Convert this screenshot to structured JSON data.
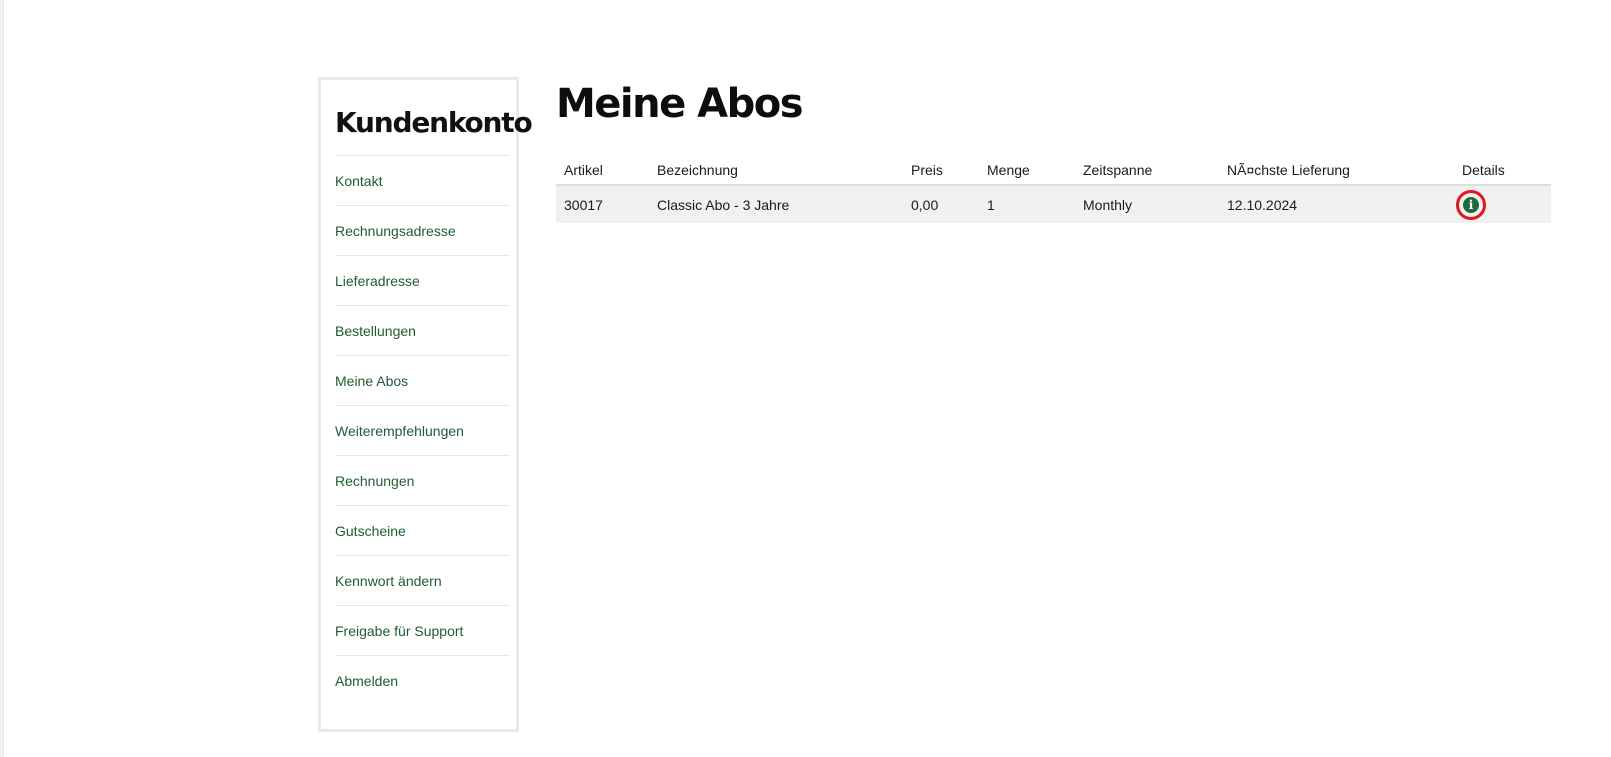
{
  "sidebar": {
    "title": "Kundenkonto",
    "items": [
      {
        "label": "Kontakt"
      },
      {
        "label": "Rechnungsadresse"
      },
      {
        "label": "Lieferadresse"
      },
      {
        "label": "Bestellungen"
      },
      {
        "label": "Meine Abos"
      },
      {
        "label": "Weiterempfehlungen"
      },
      {
        "label": "Rechnungen"
      },
      {
        "label": "Gutscheine"
      },
      {
        "label": "Kennwort ändern"
      },
      {
        "label": "Freigabe für Support"
      },
      {
        "label": "Abmelden"
      }
    ]
  },
  "main": {
    "title": "Meine Abos",
    "table": {
      "headers": {
        "artikel": "Artikel",
        "bezeichnung": "Bezeichnung",
        "preis": "Preis",
        "menge": "Menge",
        "zeitspanne": "Zeitspanne",
        "naechste": "NÃ¤chste Lieferung",
        "details": "Details"
      },
      "rows": [
        {
          "artikel": "30017",
          "bezeichnung": "Classic Abo - 3 Jahre",
          "preis": "0,00",
          "menge": "1",
          "zeitspanne": "Monthly",
          "naechste": "12.10.2024",
          "details_icon": "info-circle-icon"
        }
      ]
    }
  },
  "colors": {
    "link_green": "#1f5c34",
    "icon_green": "#1e6b3a",
    "highlight_red": "#e3161e",
    "row_bg": "#f1f1f1",
    "border_gray": "#e9e9e9"
  }
}
